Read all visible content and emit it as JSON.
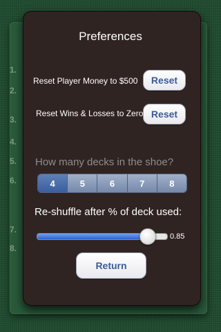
{
  "background": {
    "number_labels": [
      "1.",
      "2.",
      "3.",
      "4.",
      "5.",
      "6.",
      "7.",
      "8."
    ]
  },
  "preferences": {
    "title": "Preferences",
    "reset_money": {
      "label": "Reset Player Money to $500",
      "button": "Reset"
    },
    "reset_wins": {
      "label": "Reset Wins & Losses to Zero",
      "button": "Reset"
    },
    "decks": {
      "question": "How many decks in the shoe?",
      "options": [
        "4",
        "5",
        "6",
        "7",
        "8"
      ],
      "selected": "4"
    },
    "shuffle": {
      "label": "Re-shuffle after % of deck used:",
      "value": 0.85,
      "value_text": "0.85"
    },
    "return_button": "Return"
  },
  "colors": {
    "panel": "#302422",
    "button_text": "#3a5b9a",
    "segment_selected": "#4a6fad",
    "slider_fill": "#2a62d0"
  }
}
